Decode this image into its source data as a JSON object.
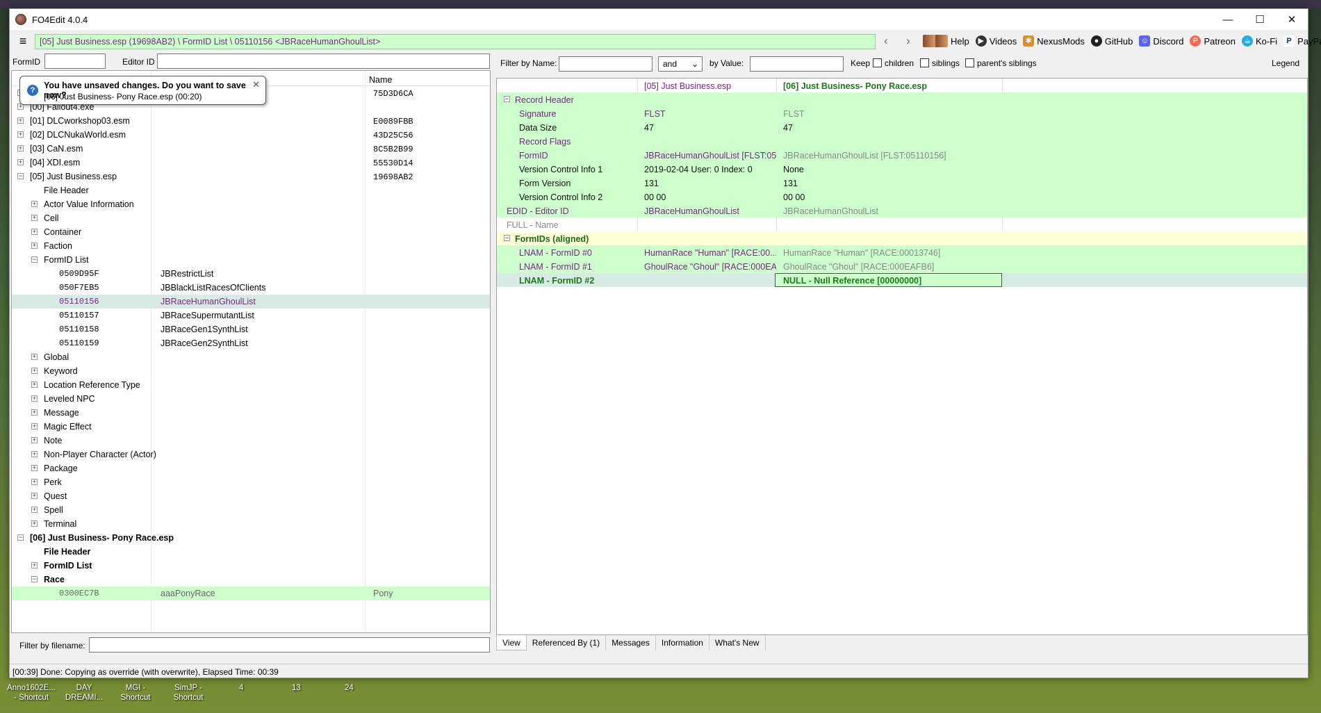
{
  "window": {
    "title": "FO4Edit 4.0.4",
    "controls": [
      "—",
      "☐",
      "✕"
    ]
  },
  "path": "[05] Just Business.esp (19698AB2) \\ FormID List \\ 05110156 <JBRaceHumanGhoulList>",
  "nav": {
    "back": "‹",
    "forward": "›"
  },
  "links": [
    "Help",
    "Videos",
    "NexusMods",
    "GitHub",
    "Discord",
    "Patreon",
    "Ko-Fi",
    "PayPal"
  ],
  "left": {
    "formid_label": "FormID",
    "editorid_label": "Editor ID",
    "col_name": "Name",
    "filter_filename_label": "Filter by filename:",
    "notice": {
      "title": "You have unsaved changes. Do you want to save now?",
      "detail": "[06] Just Business- Pony Race.esp (00:20)",
      "close": "✕"
    },
    "rows": [
      {
        "exp": "+",
        "label": "[00] Fallout4.esm",
        "c3": "75D3D6CA"
      },
      {
        "exp": "+",
        "label": "[00] Fallout4.exe",
        "c3": ""
      },
      {
        "exp": "+",
        "label": "[01] DLCworkshop03.esm",
        "c3": "E0089FBB"
      },
      {
        "exp": "+",
        "label": "[02] DLCNukaWorld.esm",
        "c3": "43D25C56"
      },
      {
        "exp": "+",
        "label": "[03] CaN.esm",
        "c3": "8C5B2B99"
      },
      {
        "exp": "+",
        "label": "[04] XDI.esm",
        "c3": "55530D14"
      },
      {
        "exp": "−",
        "label": "[05] Just Business.esp",
        "c3": "19698AB2"
      },
      {
        "exp": "",
        "label": "File Header"
      },
      {
        "exp": "+",
        "label": "Actor Value Information"
      },
      {
        "exp": "+",
        "label": "Cell"
      },
      {
        "exp": "+",
        "label": "Container"
      },
      {
        "exp": "+",
        "label": "Faction"
      },
      {
        "exp": "−",
        "label": "FormID List"
      },
      {
        "exp": "",
        "label": "0509D95F",
        "c2": "JBRestrictList"
      },
      {
        "exp": "",
        "label": "050F7EB5",
        "c2": "JBBlackListRacesOfClients"
      },
      {
        "exp": "",
        "label": "05110156",
        "c2": "JBRaceHumanGhoulList"
      },
      {
        "exp": "",
        "label": "05110157",
        "c2": "JBRaceSupermutantList"
      },
      {
        "exp": "",
        "label": "05110158",
        "c2": "JBRaceGen1SynthList"
      },
      {
        "exp": "",
        "label": "05110159",
        "c2": "JBRaceGen2SynthList"
      },
      {
        "exp": "+",
        "label": "Global"
      },
      {
        "exp": "+",
        "label": "Keyword"
      },
      {
        "exp": "+",
        "label": "Location Reference Type"
      },
      {
        "exp": "+",
        "label": "Leveled NPC"
      },
      {
        "exp": "+",
        "label": "Message"
      },
      {
        "exp": "+",
        "label": "Magic Effect"
      },
      {
        "exp": "+",
        "label": "Note"
      },
      {
        "exp": "+",
        "label": "Non-Player Character (Actor)"
      },
      {
        "exp": "+",
        "label": "Package"
      },
      {
        "exp": "+",
        "label": "Perk"
      },
      {
        "exp": "+",
        "label": "Quest"
      },
      {
        "exp": "+",
        "label": "Spell"
      },
      {
        "exp": "+",
        "label": "Terminal"
      },
      {
        "exp": "−",
        "label": "[06] Just Business- Pony Race.esp"
      },
      {
        "exp": "",
        "label": "File Header"
      },
      {
        "exp": "+",
        "label": "FormID List"
      },
      {
        "exp": "−",
        "label": "Race"
      },
      {
        "exp": "",
        "label": "0300EC7B",
        "c2": "aaaPonyRace",
        "c3": "Pony"
      }
    ]
  },
  "right": {
    "filter_name_label": "Filter by Name:",
    "op_value": "and",
    "by_value_label": "by Value:",
    "keep_label": "Keep",
    "children_label": "children",
    "siblings_label": "siblings",
    "parents_siblings_label": "parent's siblings",
    "legend_label": "Legend",
    "col1_header": "[05] Just Business.esp",
    "col2_header": "[06] Just Business- Pony Race.esp",
    "rows": [
      {
        "exp": "−",
        "label": "Record Header",
        "v1": "",
        "v2": ""
      },
      {
        "exp": "",
        "label": "Signature",
        "v1": "FLST",
        "v2": "FLST"
      },
      {
        "exp": "",
        "label": "Data Size",
        "v1": "47",
        "v2": "47"
      },
      {
        "exp": "",
        "label": "Record Flags",
        "v1": "",
        "v2": ""
      },
      {
        "exp": "",
        "label": "FormID",
        "v1": "JBRaceHumanGhoulList [FLST:05...",
        "v2": "JBRaceHumanGhoulList [FLST:05110156]"
      },
      {
        "exp": "",
        "label": "Version Control Info 1",
        "v1": "2019-02-04 User: 0 Index: 0",
        "v2": "None"
      },
      {
        "exp": "",
        "label": "Form Version",
        "v1": "131",
        "v2": "131"
      },
      {
        "exp": "",
        "label": "Version Control Info 2",
        "v1": "00 00",
        "v2": "00 00"
      },
      {
        "exp": "",
        "label": "EDID - Editor ID",
        "v1": "JBRaceHumanGhoulList",
        "v2": "JBRaceHumanGhoulList"
      },
      {
        "exp": "",
        "label": "FULL - Name",
        "v1": "",
        "v2": ""
      },
      {
        "exp": "−",
        "label": "FormIDs (aligned)",
        "v1": "",
        "v2": ""
      },
      {
        "exp": "",
        "label": "LNAM - FormID #0",
        "v1": "HumanRace \"Human\" [RACE:00...",
        "v2": "HumanRace \"Human\" [RACE:00013746]"
      },
      {
        "exp": "",
        "label": "LNAM - FormID #1",
        "v1": "GhoulRace \"Ghoul\" [RACE:000EA...",
        "v2": "GhoulRace \"Ghoul\" [RACE:000EAFB6]"
      },
      {
        "exp": "",
        "label": "LNAM - FormID #2",
        "v1": "",
        "v2": "NULL - Null Reference [00000000]"
      }
    ],
    "tabs": [
      "View",
      "Referenced By (1)",
      "Messages",
      "Information",
      "What's New"
    ]
  },
  "status": "[00:39] Done: Copying as override (with overwrite), Elapsed Time: 00:39",
  "taskbar": [
    "Anno1602E... - Shortcut",
    "DAY DREAMI...",
    "MGI - Shortcut",
    "SimJP - Shortcut",
    "4",
    "13",
    "24"
  ]
}
